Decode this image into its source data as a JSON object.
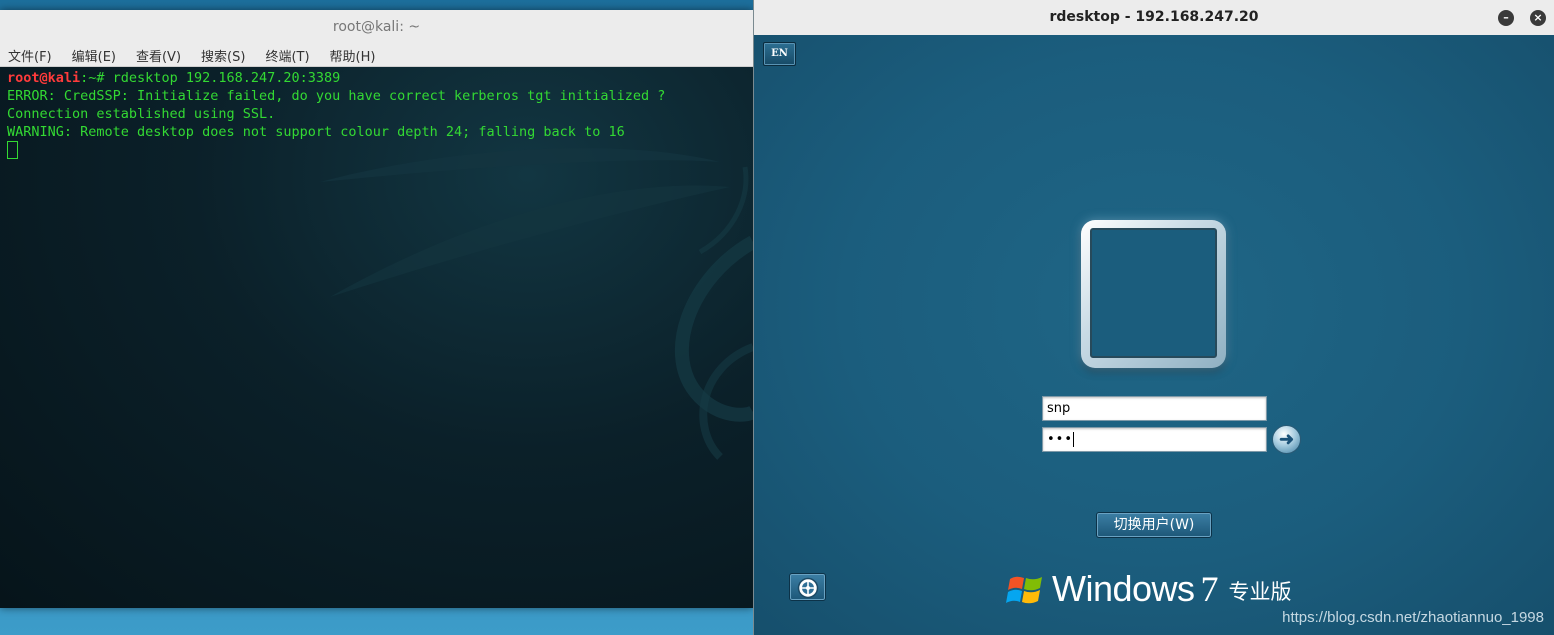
{
  "terminal": {
    "title": "root@kali: ~",
    "menu": [
      "文件(F)",
      "编辑(E)",
      "查看(V)",
      "搜索(S)",
      "终端(T)",
      "帮助(H)"
    ],
    "prompt_user": "root@kali",
    "prompt_path": ":~# ",
    "command": "rdesktop 192.168.247.20:3389",
    "output": [
      "ERROR: CredSSP: Initialize failed, do you have correct kerberos tgt initialized ?",
      "Connection established using SSL.",
      "WARNING: Remote desktop does not support colour depth 24; falling back to 16"
    ],
    "colors": {
      "text": "#33d933",
      "prompt_user": "#ff3b3b"
    }
  },
  "rdesktop": {
    "title": "rdesktop - 192.168.247.20",
    "window_buttons": {
      "minimize": "minimize-icon",
      "close": "close-icon"
    },
    "language": "EN",
    "username_value": "snp",
    "password_value": "•••",
    "submit_icon": "arrow-right-icon",
    "switch_user_label": "切换用户(W)",
    "ease_of_access_icon": "ease-of-access-icon",
    "os_brand": {
      "word": "Windows",
      "version": "7",
      "edition": "专业版"
    }
  },
  "watermark": "https://blog.csdn.net/zhaotiannuo_1998"
}
